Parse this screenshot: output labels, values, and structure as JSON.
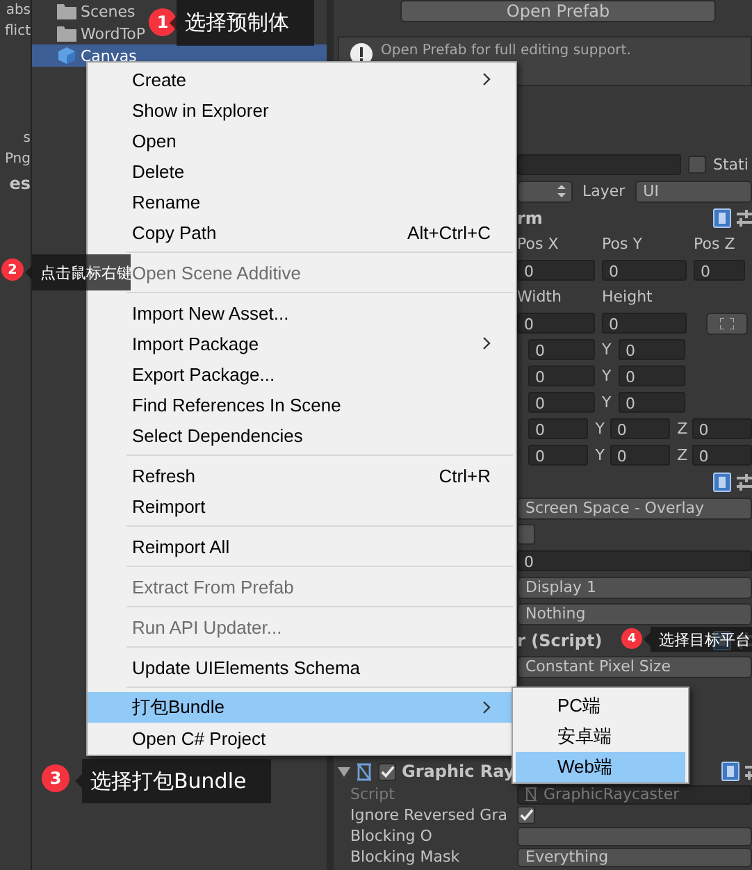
{
  "left_panel": {
    "groups": [
      {
        "items": [
          {
            "label": "abs",
            "bold": false
          },
          {
            "label": "flict",
            "bold": false
          }
        ]
      },
      {
        "items": [
          {
            "label": "s",
            "bold": false
          },
          {
            "label": "Png",
            "bold": false
          },
          {
            "label": "es",
            "bold": true
          }
        ]
      }
    ]
  },
  "project_tree": {
    "items": [
      {
        "label": "Scenes",
        "kind": "folder",
        "selected": false
      },
      {
        "label": "WordToP",
        "kind": "folder",
        "selected": false
      },
      {
        "label": "Canvas",
        "kind": "prefab",
        "selected": true
      }
    ]
  },
  "inspector": {
    "rows": [
      {
        "kind": "button",
        "label": "Open Prefab"
      },
      {
        "kind": "info",
        "text": "Open Prefab for full editing support."
      },
      {
        "kind": "name",
        "static_label": "Stati",
        "static_checked": false
      },
      {
        "kind": "layer",
        "label": "Layer",
        "value": "UI"
      },
      {
        "kind": "header",
        "title": "rm"
      },
      {
        "kind": "labels",
        "labels": [
          "Pos X",
          "Pos Y",
          "Pos Z"
        ]
      },
      {
        "kind": "fields",
        "values": [
          "0",
          "0",
          "0"
        ]
      },
      {
        "kind": "labels",
        "labels": [
          "Width",
          "Height"
        ]
      },
      {
        "kind": "fields",
        "values": [
          "0",
          "0"
        ],
        "anchor_button": true
      },
      {
        "kind": "vector",
        "values": [
          {
            "value": "0"
          },
          {
            "label": "Y",
            "value": "0"
          }
        ]
      },
      {
        "kind": "vector",
        "values": [
          {
            "value": "0"
          },
          {
            "label": "Y",
            "value": "0"
          }
        ]
      },
      {
        "kind": "vector",
        "values": [
          {
            "value": "0"
          },
          {
            "label": "Y",
            "value": "0"
          }
        ]
      },
      {
        "kind": "vector",
        "values": [
          {
            "value": "0"
          },
          {
            "label": "Y",
            "value": "0"
          },
          {
            "label": "Z",
            "value": "0"
          }
        ]
      },
      {
        "kind": "vector",
        "values": [
          {
            "value": "0"
          },
          {
            "label": "Y",
            "value": "0"
          },
          {
            "label": "Z",
            "value": "0"
          }
        ]
      },
      {
        "kind": "icons"
      },
      {
        "kind": "dropdown",
        "value": "Screen Space - Overlay"
      },
      {
        "kind": "toggle",
        "checked": false
      },
      {
        "kind": "field",
        "value": "0"
      },
      {
        "kind": "dropdown",
        "value": "Display 1"
      },
      {
        "kind": "dropdown",
        "value": "Nothing"
      },
      {
        "kind": "header",
        "title": "r (Script)"
      },
      {
        "kind": "dropdown",
        "value": "Constant Pixel Size"
      },
      {
        "kind": "component",
        "title": "Graphic Ray",
        "expanded": true,
        "enabled": true
      },
      {
        "kind": "script",
        "label": "Script",
        "value": "GraphicRaycaster"
      },
      {
        "kind": "check",
        "label": "Ignore Reversed Gra",
        "checked": true
      },
      {
        "kind": "dropdown_prop",
        "label": "Blocking O"
      },
      {
        "kind": "dropdown_prop",
        "label": "Blocking Mask",
        "value": "Everything"
      }
    ]
  },
  "context_menu": {
    "items": [
      {
        "kind": "item",
        "label": "Create",
        "submenu": true,
        "disabled": false,
        "selected": false
      },
      {
        "kind": "item",
        "label": "Show in Explorer",
        "disabled": false,
        "selected": false
      },
      {
        "kind": "item",
        "label": "Open",
        "disabled": false,
        "selected": false
      },
      {
        "kind": "item",
        "label": "Delete",
        "disabled": false,
        "selected": false
      },
      {
        "kind": "item",
        "label": "Rename",
        "disabled": false,
        "selected": false
      },
      {
        "kind": "item",
        "label": "Copy Path",
        "shortcut": "Alt+Ctrl+C",
        "disabled": false,
        "selected": false
      },
      {
        "kind": "separator"
      },
      {
        "kind": "item",
        "label": "Open Scene Additive",
        "disabled": true,
        "selected": false
      },
      {
        "kind": "separator"
      },
      {
        "kind": "item",
        "label": "Import New Asset...",
        "disabled": false,
        "selected": false
      },
      {
        "kind": "item",
        "label": "Import Package",
        "submenu": true,
        "disabled": false,
        "selected": false
      },
      {
        "kind": "item",
        "label": "Export Package...",
        "disabled": false,
        "selected": false
      },
      {
        "kind": "item",
        "label": "Find References In Scene",
        "disabled": false,
        "selected": false
      },
      {
        "kind": "item",
        "label": "Select Dependencies",
        "disabled": false,
        "selected": false
      },
      {
        "kind": "separator"
      },
      {
        "kind": "item",
        "label": "Refresh",
        "shortcut": "Ctrl+R",
        "disabled": false,
        "selected": false
      },
      {
        "kind": "item",
        "label": "Reimport",
        "disabled": false,
        "selected": false
      },
      {
        "kind": "separator"
      },
      {
        "kind": "item",
        "label": "Reimport All",
        "disabled": false,
        "selected": false
      },
      {
        "kind": "separator"
      },
      {
        "kind": "item",
        "label": "Extract From Prefab",
        "disabled": true,
        "selected": false
      },
      {
        "kind": "separator"
      },
      {
        "kind": "item",
        "label": "Run API Updater...",
        "disabled": true,
        "selected": false
      },
      {
        "kind": "separator"
      },
      {
        "kind": "item",
        "label": "Update UIElements Schema",
        "disabled": false,
        "selected": false
      },
      {
        "kind": "separator"
      },
      {
        "kind": "item",
        "label": "打包Bundle",
        "submenu": true,
        "disabled": false,
        "selected": true
      },
      {
        "kind": "item",
        "label": "Open C# Project",
        "disabled": false,
        "selected": false
      }
    ]
  },
  "submenu": {
    "items": [
      {
        "label": "PC端",
        "selected": false
      },
      {
        "label": "安卓端",
        "selected": false
      },
      {
        "label": "Web端",
        "selected": true
      }
    ]
  },
  "callouts": [
    {
      "number": "1",
      "text": "选择预制体"
    },
    {
      "number": "2",
      "text": "点击鼠标右键"
    },
    {
      "number": "3",
      "text": "选择打包Bundle"
    },
    {
      "number": "4",
      "text": "选择目标平台"
    }
  ]
}
